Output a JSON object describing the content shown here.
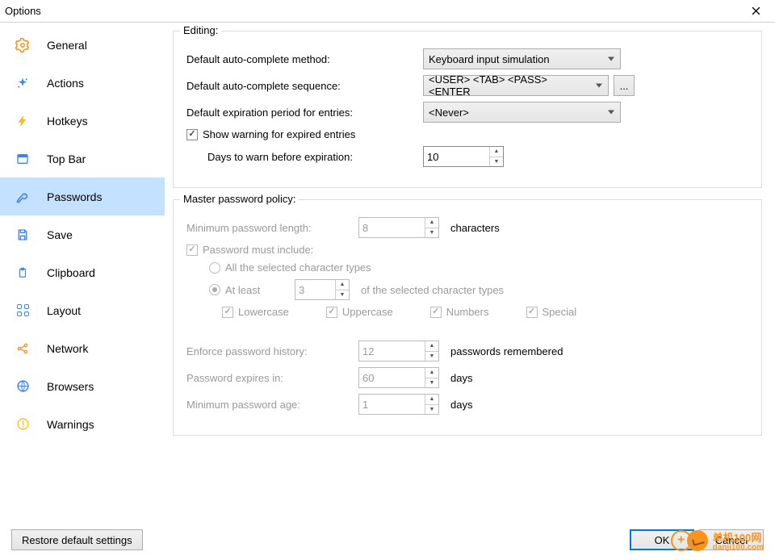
{
  "window": {
    "title": "Options"
  },
  "sidebar": {
    "items": [
      {
        "label": "General"
      },
      {
        "label": "Actions"
      },
      {
        "label": "Hotkeys"
      },
      {
        "label": "Top Bar"
      },
      {
        "label": "Passwords"
      },
      {
        "label": "Save"
      },
      {
        "label": "Clipboard"
      },
      {
        "label": "Layout"
      },
      {
        "label": "Network"
      },
      {
        "label": "Browsers"
      },
      {
        "label": "Warnings"
      }
    ]
  },
  "editing": {
    "legend": "Editing:",
    "method_label": "Default auto-complete method:",
    "method_value": "Keyboard input simulation",
    "sequence_label": "Default auto-complete sequence:",
    "sequence_value": "<USER> <TAB> <PASS> <ENTER",
    "ellipsis": "...",
    "expiration_label": "Default expiration period for entries:",
    "expiration_value": "<Never>",
    "warn_checkbox": "Show warning for expired entries",
    "days_warn_label": "Days to warn before expiration:",
    "days_warn_value": "10"
  },
  "policy": {
    "legend": "Master password policy:",
    "min_len_label": "Minimum password length:",
    "min_len_value": "8",
    "characters_suffix": "characters",
    "must_include": "Password must include:",
    "all_types": "All the selected character types",
    "at_least": "At least",
    "at_least_value": "3",
    "at_least_suffix": "of the selected character types",
    "lowercase": "Lowercase",
    "uppercase": "Uppercase",
    "numbers": "Numbers",
    "special": "Special",
    "history_label": "Enforce password history:",
    "history_value": "12",
    "history_suffix": "passwords remembered",
    "expires_label": "Password expires in:",
    "expires_value": "60",
    "days_suffix": "days",
    "min_age_label": "Minimum password age:",
    "min_age_value": "1"
  },
  "footer": {
    "restore": "Restore default settings",
    "ok": "OK",
    "cancel": "Cancel"
  },
  "watermark": {
    "title": "单机100网",
    "url": "danji100.com"
  },
  "colors": {
    "accent": "#0078d7",
    "selected": "#c4e1ff",
    "warn": "#f7931e"
  }
}
